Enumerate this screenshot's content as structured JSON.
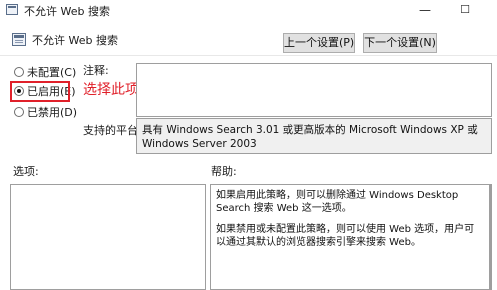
{
  "window": {
    "title": "不允许 Web 搜索",
    "minimize_glyph": "—",
    "maximize_glyph": "☐"
  },
  "header": {
    "policy_name": "不允许 Web 搜索",
    "prev_button": "上一个设置(P)",
    "next_button": "下一个设置(N)"
  },
  "options": {
    "not_configured": "未配置(C)",
    "enabled": "已启用(E)",
    "disabled": "已禁用(D)",
    "selected": "enabled"
  },
  "annotation": "选择此项",
  "comment": {
    "label": "注释:",
    "value": ""
  },
  "supported": {
    "label": "支持的平台:",
    "value": "具有 Windows Search 3.01 或更高版本的 Microsoft Windows XP 或 Windows Server 2003"
  },
  "options_panel": {
    "label": "选项:"
  },
  "help_panel": {
    "label": "帮助:",
    "paragraph1": "如果启用此策略，则可以删除通过 Windows Desktop Search 搜索 Web 这一选项。",
    "paragraph2": "如果禁用或未配置此策略，则可以使用 Web 选项，用户可以通过其默认的浏览器搜索引擎来搜索 Web。"
  },
  "colors": {
    "annotation": "#e0202a",
    "button_bg": "#e1e1e1"
  }
}
